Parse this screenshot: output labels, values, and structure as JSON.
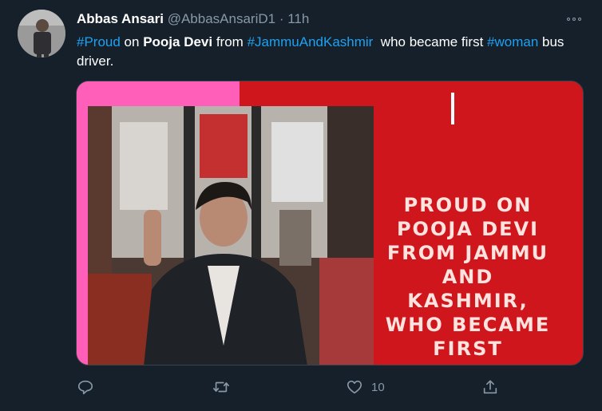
{
  "tweet": {
    "display_name": "Abbas Ansari",
    "handle": "@AbbasAnsariD1",
    "separator": "·",
    "time": "11h",
    "text_parts": {
      "tag_proud": "#Proud",
      "on": " on ",
      "name": "Pooja Devi",
      "from": " from ",
      "tag_jk": "#JammuAndKashmir",
      "who": "  who became first ",
      "tag_woman": "#woman",
      "end": " bus driver."
    },
    "media_overlay_text": "PROUD ON\nPOOJA DEVI\nFROM JAMMU\nAND KASHMIR,\nWHO BECAME\nFIRST WOMAN\nBUS DRIVER.",
    "like_count": "10"
  },
  "icons": {
    "more": "more-horizontal-icon",
    "reply": "reply-icon",
    "retweet": "retweet-icon",
    "like": "heart-icon",
    "share": "share-icon"
  },
  "colors": {
    "background": "#15202b",
    "link": "#1da1f2",
    "secondary": "#8899a6",
    "media_red": "#d0161d",
    "media_pink": "#ff5fb9"
  }
}
